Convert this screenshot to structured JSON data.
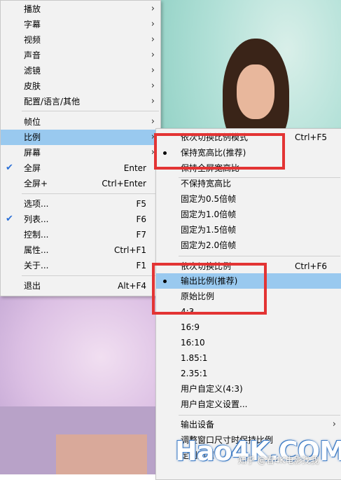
{
  "main_menu": {
    "items": [
      {
        "label": "播放",
        "submenu": true
      },
      {
        "label": "字幕",
        "submenu": true
      },
      {
        "label": "视频",
        "submenu": true
      },
      {
        "label": "声音",
        "submenu": true
      },
      {
        "label": "滤镜",
        "submenu": true
      },
      {
        "label": "皮肤",
        "submenu": true
      },
      {
        "label": "配置/语言/其他",
        "submenu": true
      },
      {
        "label": "帧位",
        "submenu": true
      },
      {
        "label": "比例",
        "submenu": true,
        "active": true
      },
      {
        "label": "屏幕",
        "submenu": true
      },
      {
        "label": "全屏",
        "shortcut": "Enter",
        "checked": true
      },
      {
        "label": "全屏+",
        "shortcut": "Ctrl+Enter"
      },
      {
        "label": "选项...",
        "shortcut": "F5"
      },
      {
        "label": "列表...",
        "shortcut": "F6",
        "checked": true
      },
      {
        "label": "控制...",
        "shortcut": "F7"
      },
      {
        "label": "属性...",
        "shortcut": "Ctrl+F1"
      },
      {
        "label": "关于...",
        "shortcut": "F1"
      },
      {
        "label": "退出",
        "shortcut": "Alt+F4"
      }
    ]
  },
  "ratio_submenu": {
    "items": [
      {
        "label": "依次切换比例模式",
        "shortcut": "Ctrl+F5"
      },
      {
        "label": "保持宽高比(推荐)",
        "selected": true
      },
      {
        "label": "保持全屏宽高比"
      },
      {
        "label": "不保持宽高比"
      },
      {
        "label": "固定为0.5倍帧"
      },
      {
        "label": "固定为1.0倍帧"
      },
      {
        "label": "固定为1.5倍帧"
      },
      {
        "label": "固定为2.0倍帧"
      },
      {
        "label": "依次切换比例",
        "shortcut": "Ctrl+F6"
      },
      {
        "label": "输出比例(推荐)",
        "selected": true,
        "active": true
      },
      {
        "label": "原始比例"
      },
      {
        "label": "4:3"
      },
      {
        "label": "16:9"
      },
      {
        "label": "16:10"
      },
      {
        "label": "1.85:1"
      },
      {
        "label": "2.35:1"
      },
      {
        "label": "用户自定义(4:3)"
      },
      {
        "label": "用户自定义设置..."
      },
      {
        "label": "输出设备",
        "submenu": true
      },
      {
        "label": "调整窗口尺寸时保持比例"
      },
      {
        "label": "定制边框"
      }
    ]
  },
  "icons": {
    "check": "✔",
    "arrow": "›"
  },
  "colors": {
    "highlight": "#99c9ef",
    "annotation": "#e33434",
    "menu_bg": "#f2f2f2"
  },
  "watermark": {
    "logo": "Hao4K.COM",
    "caption": "知乎 @看4K电影找我"
  }
}
